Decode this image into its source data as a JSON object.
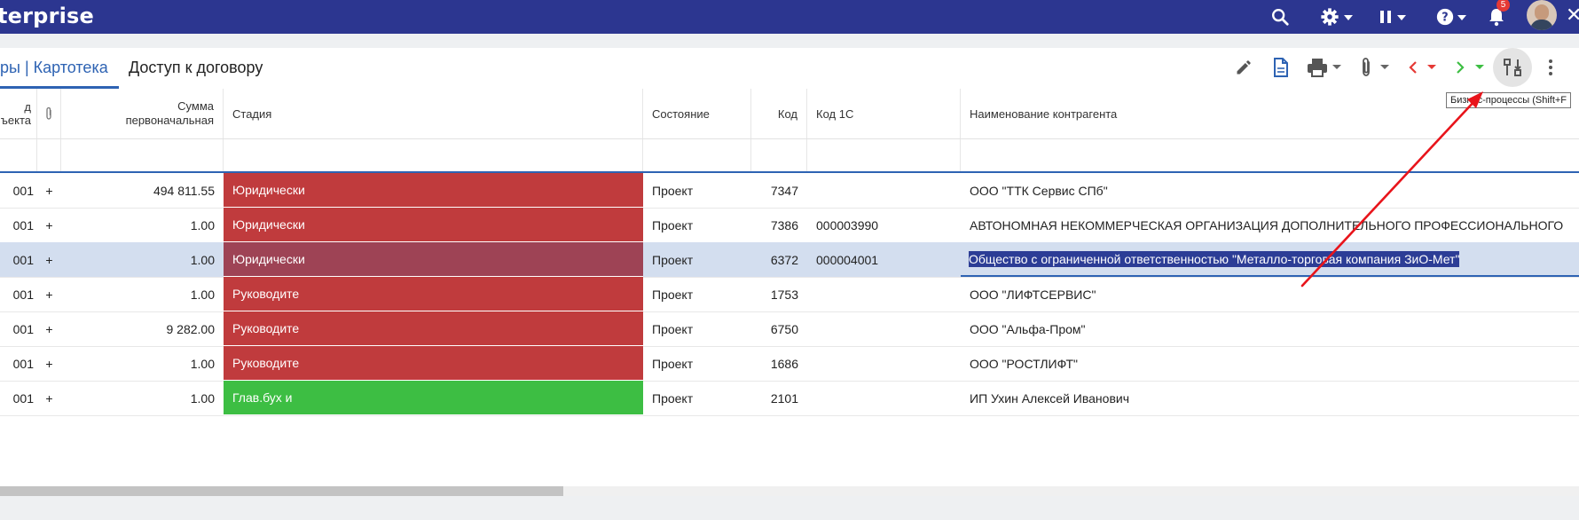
{
  "app": {
    "brand": "terprise",
    "notifications_count": "5"
  },
  "tabs": [
    {
      "label": "ры | Картотека"
    },
    {
      "label": "Доступ к договору"
    }
  ],
  "tooltip": "Бизнес-процессы (Shift+F",
  "columns": {
    "id_object": "д\nъекта",
    "sum": "Сумма\nпервоначальная",
    "stage": "Стадия",
    "state": "Состояние",
    "code": "Код",
    "code1c": "Код 1С",
    "counterparty": "Наименование контрагента"
  },
  "rows": [
    {
      "id": "001",
      "attach": "+",
      "sum": "494 811.55",
      "stage": "Юридически",
      "stage_color": "#c03b3d",
      "state": "Проект",
      "code": "7347",
      "code1c": "",
      "counterparty": "ООО \"ТТК Сервис СПб\""
    },
    {
      "id": "001",
      "attach": "+",
      "sum": "1.00",
      "stage": "Юридически",
      "stage_color": "#c03b3d",
      "state": "Проект",
      "code": "7386",
      "code1c": "000003990",
      "counterparty": "АВТОНОМНАЯ НЕКОММЕРЧЕСКАЯ ОРГАНИЗАЦИЯ ДОПОЛНИТЕЛЬНОГО ПРОФЕССИОНАЛЬНОГО"
    },
    {
      "id": "001",
      "attach": "+",
      "sum": "1.00",
      "stage": "Юридически",
      "stage_color": "#9e4355",
      "state": "Проект",
      "code": "6372",
      "code1c": "000004001",
      "counterparty": "Общество с ограниченной ответственностью \"Металло-торговая компания ЗиО-Мет\""
    },
    {
      "id": "001",
      "attach": "+",
      "sum": "1.00",
      "stage": "Руководите",
      "stage_color": "#c03b3d",
      "state": "Проект",
      "code": "1753",
      "code1c": "",
      "counterparty": "ООО \"ЛИФТСЕРВИС\""
    },
    {
      "id": "001",
      "attach": "+",
      "sum": "9 282.00",
      "stage": "Руководите",
      "stage_color": "#c03b3d",
      "state": "Проект",
      "code": "6750",
      "code1c": "",
      "counterparty": "ООО \"Альфа-Пром\""
    },
    {
      "id": "001",
      "attach": "+",
      "sum": "1.00",
      "stage": "Руководите",
      "stage_color": "#c03b3d",
      "state": "Проект",
      "code": "1686",
      "code1c": "",
      "counterparty": "ООО \"РОСТЛИФТ\""
    },
    {
      "id": "001",
      "attach": "+",
      "sum": "1.00",
      "stage": "Глав.бух и",
      "stage_color": "#3dbe43",
      "state": "Проект",
      "code": "2101",
      "code1c": "",
      "counterparty": "ИП Ухин Алексей Иванович"
    }
  ],
  "colors": {
    "topbar": "#2c3690",
    "accent": "#2e63b3",
    "selected_row": "#d3deef",
    "stage_red": "#c03b3d",
    "stage_green": "#3dbe43",
    "annotation_arrow": "#e8141b"
  }
}
